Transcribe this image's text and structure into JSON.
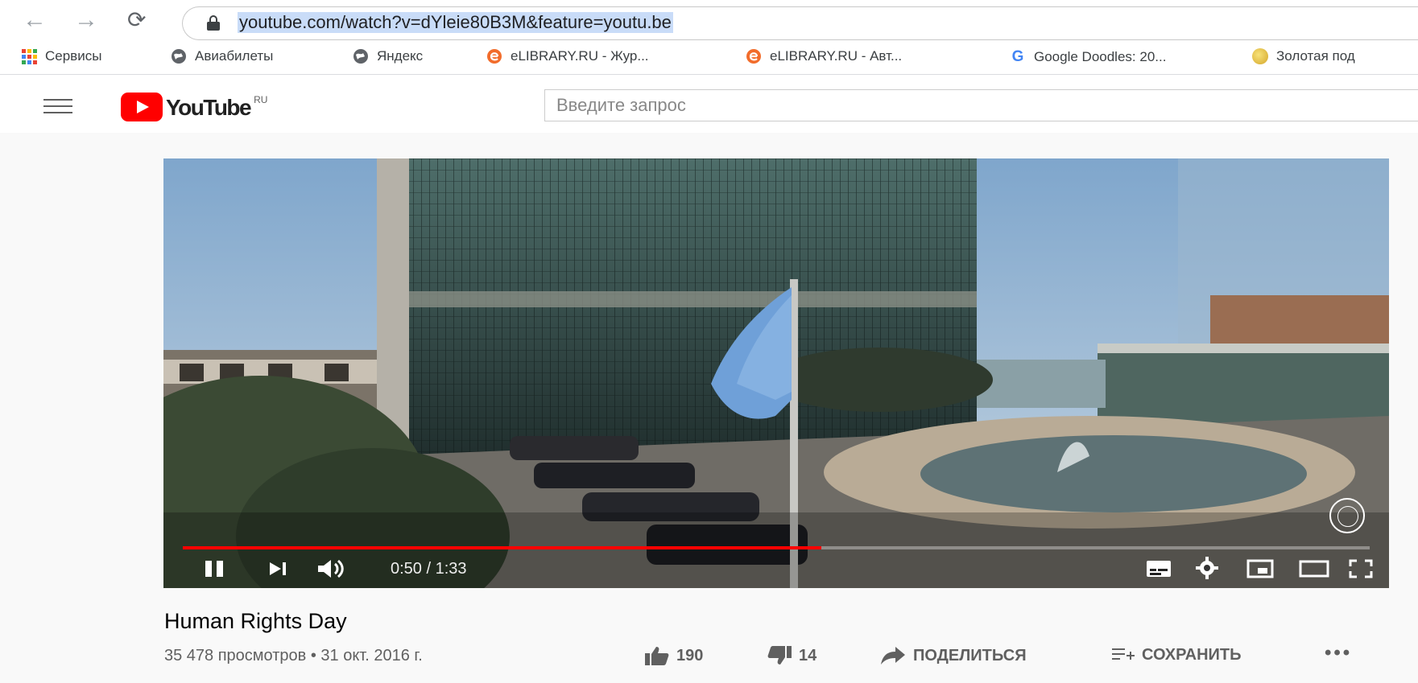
{
  "browser": {
    "url": "youtube.com/watch?v=dYleie80B3M&feature=youtu.be",
    "bookmarks": [
      {
        "label": "Сервисы",
        "icon": "apps-icon"
      },
      {
        "label": "Авиабилеты",
        "icon": "globe-icon"
      },
      {
        "label": "Яндекс",
        "icon": "globe-icon"
      },
      {
        "label": "eLIBRARY.RU - Жур...",
        "icon": "elibrary-icon"
      },
      {
        "label": "eLIBRARY.RU - Авт...",
        "icon": "elibrary-icon"
      },
      {
        "label": "Google Doodles: 20...",
        "icon": "google-icon"
      },
      {
        "label": "Золотая под",
        "icon": "gold-circle-icon"
      }
    ]
  },
  "youtube": {
    "logo_text": "YouTube",
    "logo_region": "RU",
    "search_placeholder": "Введите запрос"
  },
  "player": {
    "current_time": "0:50",
    "duration": "1:33",
    "time_display": "0:50 / 1:33",
    "progress_fraction": 0.538
  },
  "video": {
    "title": "Human Rights Day",
    "views": "35 478 просмотров",
    "date": "31 окт. 2016 г.",
    "likes": "190",
    "dislikes": "14",
    "share_label": "ПОДЕЛИТЬСЯ",
    "save_label": "СОХРАНИТЬ"
  },
  "colors": {
    "accent": "#ff0000",
    "text_secondary": "#606060",
    "url_selection": "#c9dcf8"
  }
}
